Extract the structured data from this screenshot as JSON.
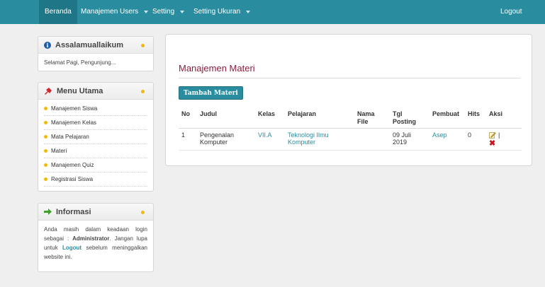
{
  "nav": {
    "items": [
      {
        "label": "Beranda",
        "active": true
      },
      {
        "label": "Manajemen Users",
        "dropdown": true
      },
      {
        "label": "Setting",
        "dropdown": true
      },
      {
        "label": "Setting Ukuran",
        "dropdown": true
      }
    ],
    "logout": "Logout"
  },
  "sidebar": {
    "welcome": {
      "title": "Assalamuallaikum",
      "text": "Selamat Pagi, Pengunjung..."
    },
    "menu": {
      "title": "Menu Utama",
      "items": [
        "Manajemen Siswa",
        "Manajemen Kelas",
        "Mata Pelajaran",
        "Materi",
        "Manajemen Quiz",
        "Registrasi Siswa"
      ]
    },
    "info": {
      "title": "Informasi",
      "line1": "Anda masih dalam keadaan login sebagai :",
      "role": "Administrator",
      "period": ".",
      "line2a": "Jangan lupa untuk",
      "logout_link": "Logout",
      "line2b": "sebelum meninggalkan website ini."
    }
  },
  "main": {
    "title": "Manajemen Materi",
    "add_button": "Tambah Materi",
    "table": {
      "headers": [
        "No",
        "Judul",
        "Kelas",
        "Pelajaran",
        "Nama File",
        "Tgl Posting",
        "Pembuat",
        "Hits",
        "Aksi"
      ],
      "rows": [
        {
          "no": "1",
          "judul": "Pengenalan Komputer",
          "kelas": "VII.A",
          "pelajaran": "Teknologi Ilmu Komputer",
          "nama_file": "",
          "tgl": "09 Juli 2019",
          "pembuat": "Asep",
          "hits": "0",
          "separator": "|"
        }
      ]
    }
  },
  "icons": [
    "info-icon",
    "pin-icon",
    "arrow-right-icon",
    "edit-icon",
    "delete-icon",
    "bullet-icon"
  ],
  "colors": {
    "nav": "#2a8d9f",
    "title": "#8a1e3c",
    "link": "#2a8d9f",
    "bullet": "#f0b90b"
  }
}
